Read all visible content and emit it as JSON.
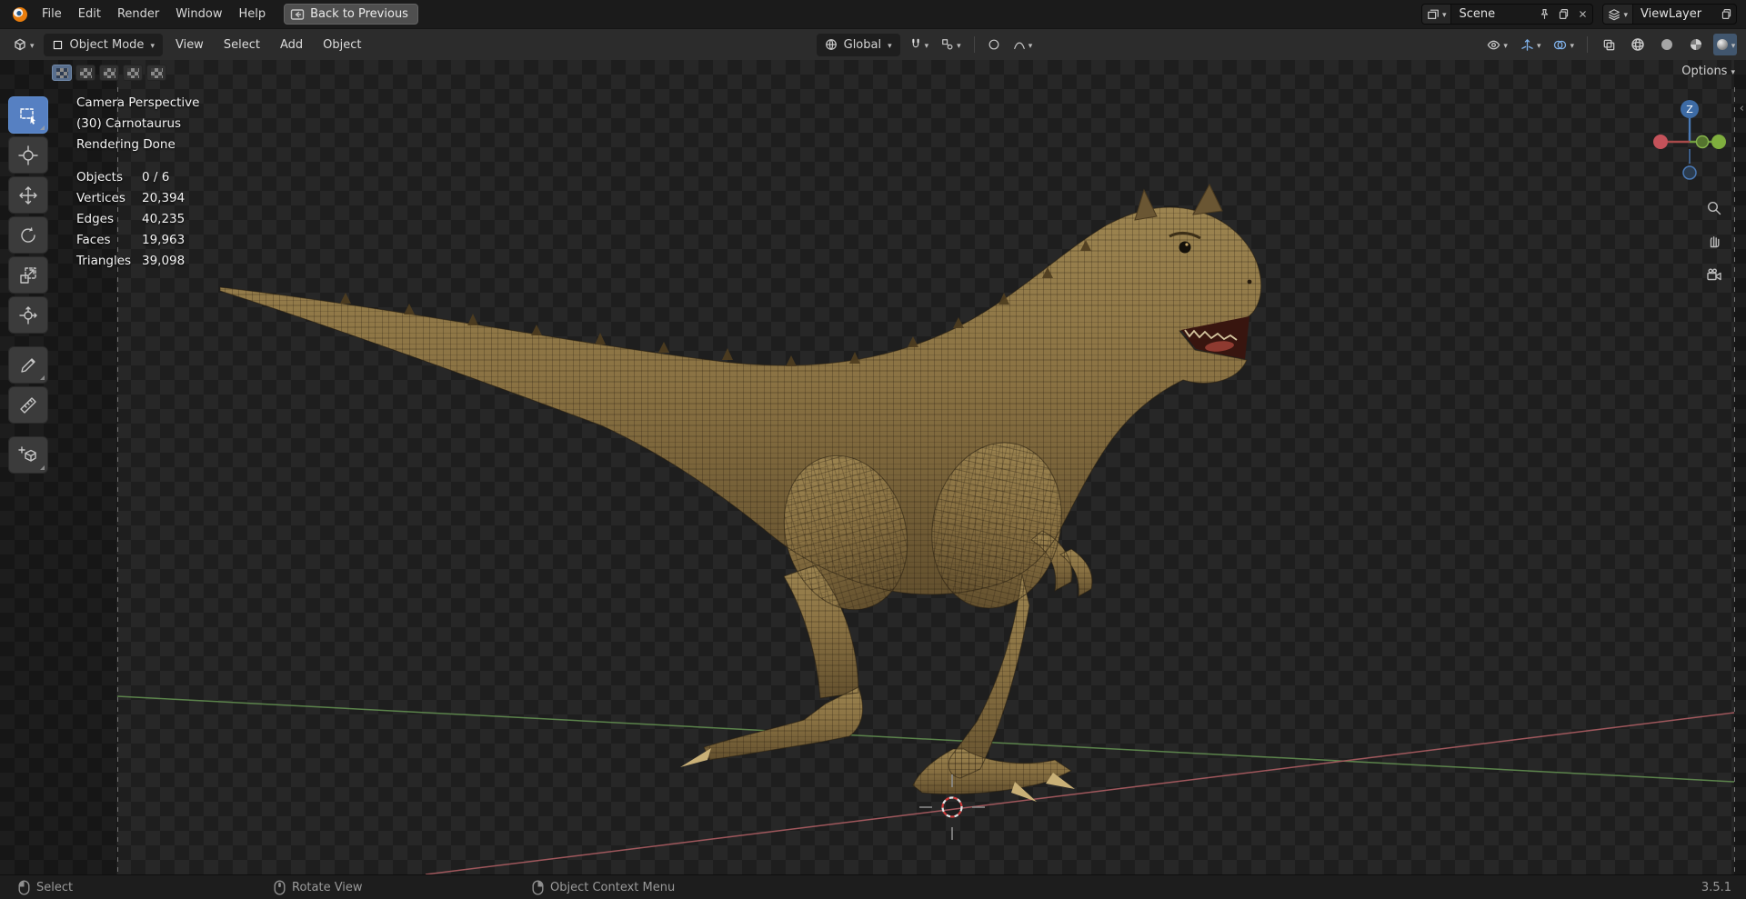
{
  "topbar": {
    "menus": [
      "File",
      "Edit",
      "Render",
      "Window",
      "Help"
    ],
    "back_button": "Back to Previous",
    "scene_field": "Scene",
    "viewlayer_field": "ViewLayer"
  },
  "viewport_header": {
    "mode": "Object Mode",
    "menus": [
      "View",
      "Select",
      "Add",
      "Object"
    ],
    "orientation": "Global",
    "options": "Options"
  },
  "tool_settings": {
    "select_modes": [
      "new",
      "extend",
      "subtract",
      "invert",
      "intersect"
    ]
  },
  "tools": [
    "select-box",
    "cursor",
    "move",
    "rotate",
    "scale",
    "transform",
    "annotate",
    "measure",
    "add-cube"
  ],
  "viewport": {
    "view_label": "Camera Perspective",
    "object_label": "(30) Carnotaurus",
    "render_status": "Rendering Done",
    "stats": {
      "rows": [
        {
          "label": "Objects",
          "value": "0 / 6"
        },
        {
          "label": "Vertices",
          "value": "20,394"
        },
        {
          "label": "Edges",
          "value": "40,235"
        },
        {
          "label": "Faces",
          "value": "19,963"
        },
        {
          "label": "Triangles",
          "value": "39,098"
        }
      ]
    },
    "gizmo": {
      "axis_z": "Z"
    }
  },
  "statusbar": {
    "select": "Select",
    "rotate_view": "Rotate View",
    "context_menu": "Object Context Menu",
    "version": "3.5.1"
  },
  "icons": {
    "chevron_down": "▾",
    "collapse_left": "‹"
  },
  "colors": {
    "accent_blue": "#5680c2",
    "topbar_bg": "#1b1b1b",
    "header_bg": "#2c2c2c",
    "axis_green": "#5f8a4e",
    "axis_red": "#a85b60",
    "dino_skin": "#8a7243"
  }
}
